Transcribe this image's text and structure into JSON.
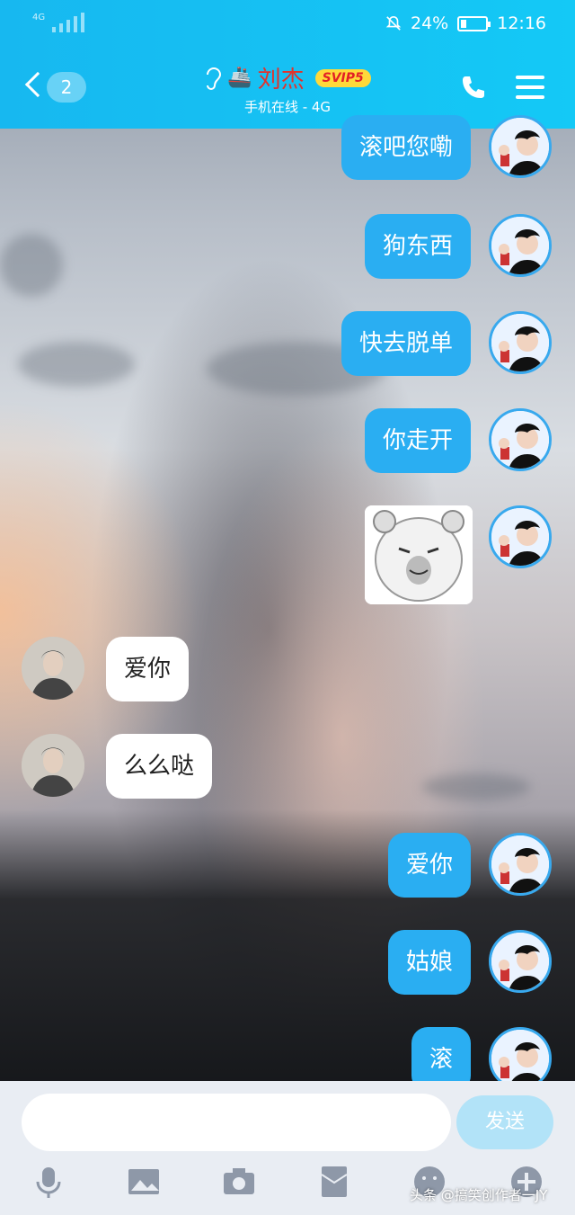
{
  "status_bar": {
    "network": "4G",
    "battery": "24%",
    "battery_level": 0.24,
    "time": "12:16"
  },
  "header": {
    "back_count": "2",
    "contact_name": "刘杰",
    "vip_badge": "SVIP5",
    "subtitle": "手机在线 - 4G"
  },
  "colors": {
    "accent": "#17b8f0",
    "my_bubble": "#2aaef2",
    "name": "#e3322b",
    "vip": "#ffd93a"
  },
  "messages": [
    {
      "side": "me",
      "text": "滚吧您嘞"
    },
    {
      "side": "me",
      "text": "狗东西"
    },
    {
      "side": "me",
      "text": "快去脱单"
    },
    {
      "side": "me",
      "text": "你走开"
    },
    {
      "side": "me",
      "type": "sticker",
      "text": ""
    },
    {
      "side": "other",
      "text": "爱你"
    },
    {
      "side": "other",
      "text": "么么哒"
    },
    {
      "side": "me",
      "text": "爱你"
    },
    {
      "side": "me",
      "text": "姑娘"
    },
    {
      "side": "me",
      "text": "滚"
    }
  ],
  "composer": {
    "placeholder": "",
    "send_label": "发送",
    "tools": [
      "microphone-icon",
      "image-icon",
      "camera-icon",
      "red-packet-icon",
      "emoji-icon",
      "plus-icon"
    ]
  },
  "watermark": "头条 @搞笑创作者一JY"
}
